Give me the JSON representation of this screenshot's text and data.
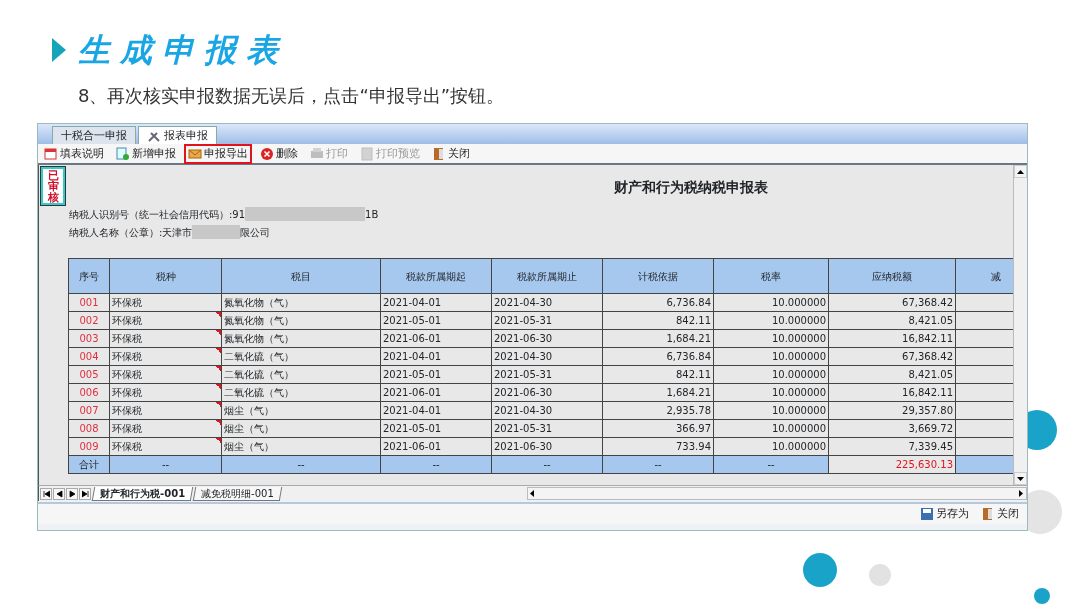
{
  "slide": {
    "title": "生成申报表",
    "instruction": "8、再次核实申报数据无误后，点击“申报导出”按钮。"
  },
  "window": {
    "tabs": [
      {
        "label": "十税合一申报",
        "selected": false
      },
      {
        "label": "报表申报",
        "selected": true
      }
    ],
    "toolbar": [
      {
        "label": "填表说明",
        "disabled": false,
        "highlighted": false
      },
      {
        "label": "新增申报",
        "disabled": false,
        "highlighted": false
      },
      {
        "label": "申报导出",
        "disabled": false,
        "highlighted": true
      },
      {
        "label": "删除",
        "disabled": false,
        "highlighted": false
      },
      {
        "label": "打印",
        "disabled": true,
        "highlighted": false
      },
      {
        "label": "打印预览",
        "disabled": true,
        "highlighted": false
      },
      {
        "label": "关闭",
        "disabled": false,
        "highlighted": false
      }
    ],
    "stamp": "已审核",
    "report": {
      "title": "财产和行为税纳税申报表",
      "taxpayer_id_prefix": "纳税人识别号（统一社会信用代码）:91",
      "taxpayer_id_suffix": "1B",
      "taxpayer_name_prefix": "纳税人名称（公章）:天津市",
      "taxpayer_name_suffix": "限公司"
    },
    "table": {
      "columns": [
        "序号",
        "税种",
        "税目",
        "税款所属期起",
        "税款所属期止",
        "计税依据",
        "税率",
        "应纳税额",
        "减"
      ],
      "rows": [
        {
          "cells": [
            "001",
            "环保税",
            "氮氧化物（气）",
            "2021-04-01",
            "2021-04-30",
            "6,736.84",
            "10.000000",
            "67,368.42"
          ],
          "flagged": false
        },
        {
          "cells": [
            "002",
            "环保税",
            "氮氧化物（气）",
            "2021-05-01",
            "2021-05-31",
            "842.11",
            "10.000000",
            "8,421.05"
          ],
          "flagged": true
        },
        {
          "cells": [
            "003",
            "环保税",
            "氮氧化物（气）",
            "2021-06-01",
            "2021-06-30",
            "1,684.21",
            "10.000000",
            "16,842.11"
          ],
          "flagged": true
        },
        {
          "cells": [
            "004",
            "环保税",
            "二氧化硫（气）",
            "2021-04-01",
            "2021-04-30",
            "6,736.84",
            "10.000000",
            "67,368.42"
          ],
          "flagged": true
        },
        {
          "cells": [
            "005",
            "环保税",
            "二氧化硫（气）",
            "2021-05-01",
            "2021-05-31",
            "842.11",
            "10.000000",
            "8,421.05"
          ],
          "flagged": true
        },
        {
          "cells": [
            "006",
            "环保税",
            "二氧化硫（气）",
            "2021-06-01",
            "2021-06-30",
            "1,684.21",
            "10.000000",
            "16,842.11"
          ],
          "flagged": true
        },
        {
          "cells": [
            "007",
            "环保税",
            "烟尘（气）",
            "2021-04-01",
            "2021-04-30",
            "2,935.78",
            "10.000000",
            "29,357.80"
          ],
          "flagged": true
        },
        {
          "cells": [
            "008",
            "环保税",
            "烟尘（气）",
            "2021-05-01",
            "2021-05-31",
            "366.97",
            "10.000000",
            "3,669.72"
          ],
          "flagged": true
        },
        {
          "cells": [
            "009",
            "环保税",
            "烟尘（气）",
            "2021-06-01",
            "2021-06-30",
            "733.94",
            "10.000000",
            "7,339.45"
          ],
          "flagged": true
        }
      ],
      "total": [
        "合计",
        "--",
        "--",
        "--",
        "--",
        "--",
        "--",
        "225,630.13"
      ]
    },
    "sheet_tabs": [
      {
        "label": "财产和行为税-001",
        "selected": true
      },
      {
        "label": "减免税明细-001",
        "selected": false
      }
    ],
    "footer_buttons": [
      "另存为",
      "关闭"
    ]
  }
}
